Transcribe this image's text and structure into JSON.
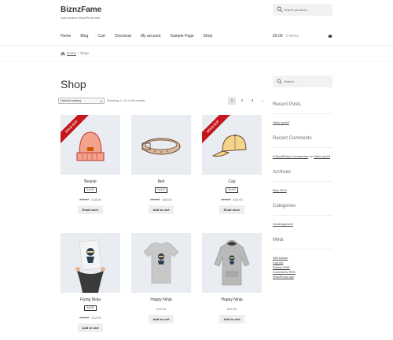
{
  "site": {
    "title": "BiznzFame",
    "tagline": "Just another WordPress site"
  },
  "header_search": {
    "placeholder": "Search products…",
    "icon": "search-icon"
  },
  "nav": {
    "items": [
      "Home",
      "Blog",
      "Cart",
      "Checkout",
      "My account",
      "Sample Page",
      "Shop"
    ]
  },
  "cart": {
    "total": "£0.00",
    "items": "0 items",
    "icon": "basket-icon"
  },
  "breadcrumb": {
    "home": "Home",
    "separator": "/",
    "current": "Shop"
  },
  "page": {
    "title": "Shop"
  },
  "toolbar": {
    "sorting_value": "Default sorting",
    "result_count": "Showing 1–12 of 16 results",
    "pages": [
      "1",
      "2",
      "3",
      "→"
    ],
    "current_page": "1"
  },
  "products": [
    {
      "name": "Beanie",
      "sku": "SALE!",
      "old_price": "£20.00",
      "price": "£18.00",
      "button": "Read more",
      "sold_out": true,
      "sold_label": "SOLD OUT",
      "image": "beanie"
    },
    {
      "name": "Belt",
      "sku": "SALE!",
      "old_price": "£65.00",
      "price": "£55.00",
      "button": "Add to cart",
      "sold_out": false,
      "image": "belt"
    },
    {
      "name": "Cap",
      "sku": "SALE!",
      "old_price": "£18.00",
      "price": "£16.00",
      "button": "Read more",
      "sold_out": true,
      "sold_label": "SOLD OUT",
      "image": "cap"
    },
    {
      "name": "Flying Ninja",
      "sku": "SALE!",
      "old_price": "£15.00",
      "price": "£12.00",
      "button": "Add to cart",
      "sold_out": false,
      "image": "ninja-poster"
    },
    {
      "name": "Happy Ninja",
      "sku": "",
      "old_price": "",
      "price": "£18.00",
      "button": "Add to cart",
      "sold_out": false,
      "image": "ninja-tshirt"
    },
    {
      "name": "Happy Ninja",
      "sku": "",
      "old_price": "",
      "price": "£35.00",
      "button": "Add to cart",
      "sold_out": false,
      "image": "ninja-hoodie"
    }
  ],
  "sidebar": {
    "search_placeholder": "Search …",
    "recent_posts": {
      "title": "Recent Posts",
      "items": [
        "Hello world!"
      ]
    },
    "recent_comments": {
      "title": "Recent Comments",
      "commenter": "A WordPress Commenter",
      "on": "on",
      "post": "Hello world!"
    },
    "archives": {
      "title": "Archives",
      "items": [
        "May 2018"
      ]
    },
    "categories": {
      "title": "Categories",
      "items": [
        "Uncategorized"
      ]
    },
    "meta": {
      "title": "Meta",
      "items": [
        "Site Admin",
        "Log out",
        "Entries RSS",
        "Comments RSS",
        "WordPress.org"
      ]
    }
  },
  "colors": {
    "accent": "#333333",
    "ribbon": "#c4161c",
    "image_bg": "#e9edf1",
    "button_bg": "#eeeeee"
  }
}
